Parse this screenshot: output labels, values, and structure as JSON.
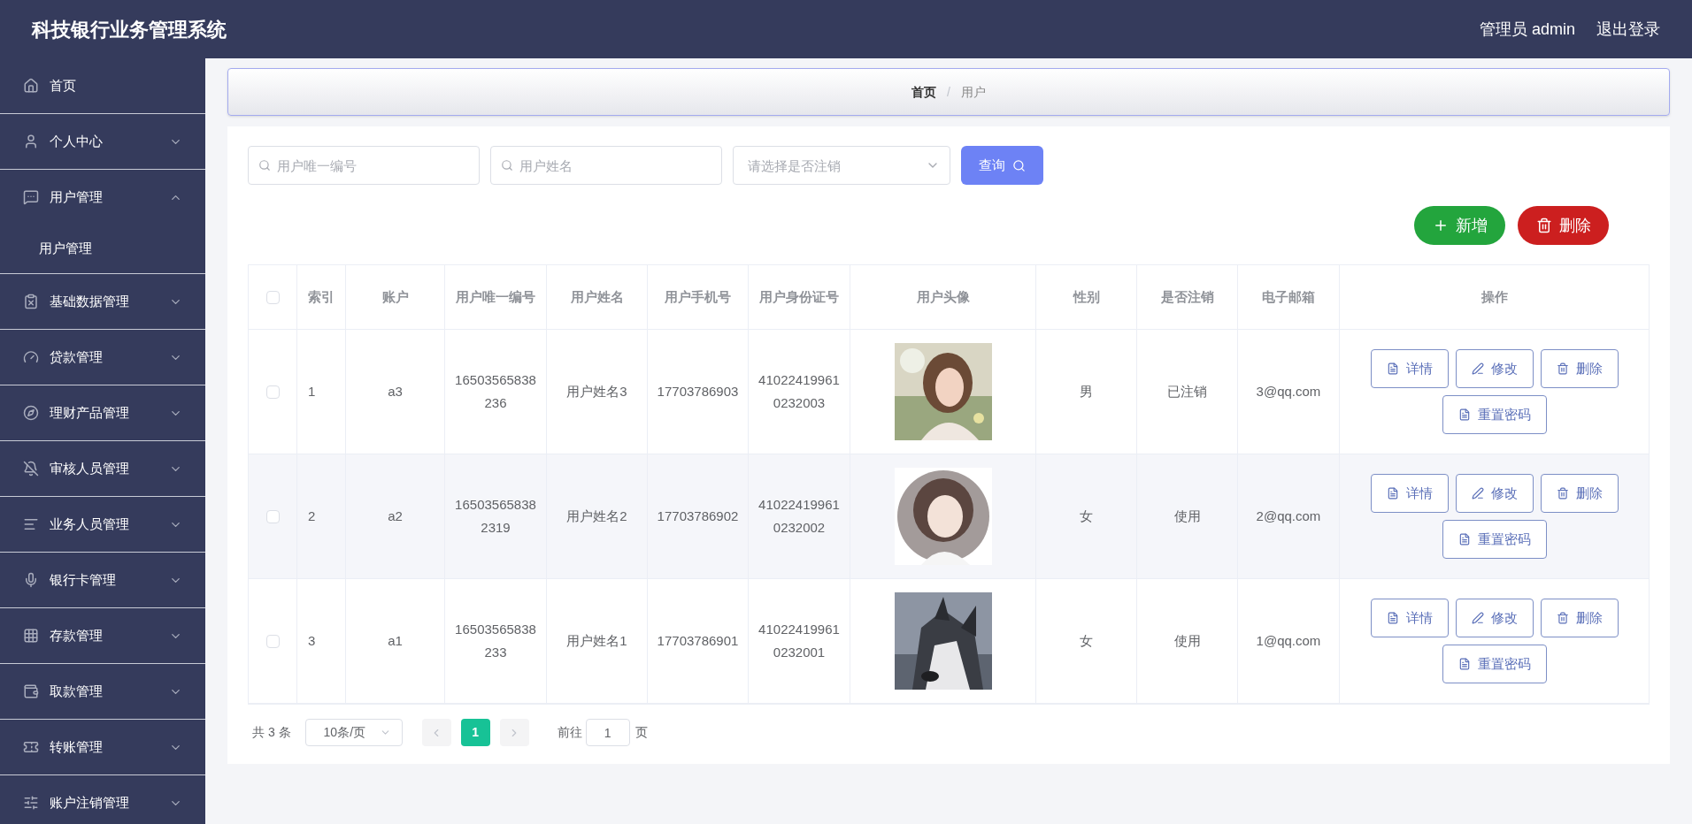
{
  "header": {
    "title": "科技银行业务管理系统",
    "user": "管理员 admin",
    "logout": "退出登录"
  },
  "sidebar": {
    "items": [
      {
        "label": "首页"
      },
      {
        "label": "个人中心",
        "expandable": true,
        "expanded": false
      },
      {
        "label": "用户管理",
        "expandable": true,
        "expanded": true,
        "children": [
          {
            "label": "用户管理"
          }
        ]
      },
      {
        "label": "基础数据管理",
        "expandable": true,
        "expanded": false
      },
      {
        "label": "贷款管理",
        "expandable": true,
        "expanded": false
      },
      {
        "label": "理财产品管理",
        "expandable": true,
        "expanded": false
      },
      {
        "label": "审核人员管理",
        "expandable": true,
        "expanded": false
      },
      {
        "label": "业务人员管理",
        "expandable": true,
        "expanded": false
      },
      {
        "label": "银行卡管理",
        "expandable": true,
        "expanded": false
      },
      {
        "label": "存款管理",
        "expandable": true,
        "expanded": false
      },
      {
        "label": "取款管理",
        "expandable": true,
        "expanded": false
      },
      {
        "label": "转账管理",
        "expandable": true,
        "expanded": false
      },
      {
        "label": "账户注销管理",
        "expandable": true,
        "expanded": false
      }
    ]
  },
  "breadcrumb": {
    "items": [
      "首页",
      "用户"
    ],
    "separator": "/"
  },
  "filters": {
    "id_placeholder": "用户唯一编号",
    "name_placeholder": "用户姓名",
    "status_placeholder": "请选择是否注销",
    "query": "查询"
  },
  "actions": {
    "add": "新增",
    "delete": "删除"
  },
  "table": {
    "select_all": {
      "checked": false
    },
    "columns": [
      "索引",
      "账户",
      "用户唯一编号",
      "用户姓名",
      "用户手机号",
      "用户身份证号",
      "用户头像",
      "性别",
      "是否注销",
      "电子邮箱",
      "操作"
    ],
    "rows": [
      {
        "selected": false,
        "cells": [
          "1",
          "a3",
          "16503565838236",
          "用户姓名3",
          "17703786903",
          "410224199610232003",
          {
            "kind": "picture"
          },
          "男",
          "已注销",
          "3@qq.com"
        ],
        "actions": [
          "详情",
          "修改",
          "删除",
          "重置密码"
        ]
      },
      {
        "selected": false,
        "cells": [
          "2",
          "a2",
          "165035658382319",
          "用户姓名2",
          "17703786902",
          "410224199610232002",
          {
            "kind": "picture"
          },
          "女",
          "使用",
          "2@qq.com"
        ],
        "actions": [
          "详情",
          "修改",
          "删除",
          "重置密码"
        ]
      },
      {
        "selected": false,
        "cells": [
          "3",
          "a1",
          "16503565838233",
          "用户姓名1",
          "17703786901",
          "410224199610232001",
          {
            "kind": "picture"
          },
          "女",
          "使用",
          "1@qq.com"
        ],
        "actions": [
          "详情",
          "修改",
          "删除",
          "重置密码"
        ]
      }
    ]
  },
  "pagination": {
    "total": "共 3 条",
    "page_size": "10条/页",
    "pages": [
      {
        "label": "1",
        "selected": true
      }
    ],
    "goto": "前往",
    "goto_value": "1",
    "page_unit": "页"
  }
}
